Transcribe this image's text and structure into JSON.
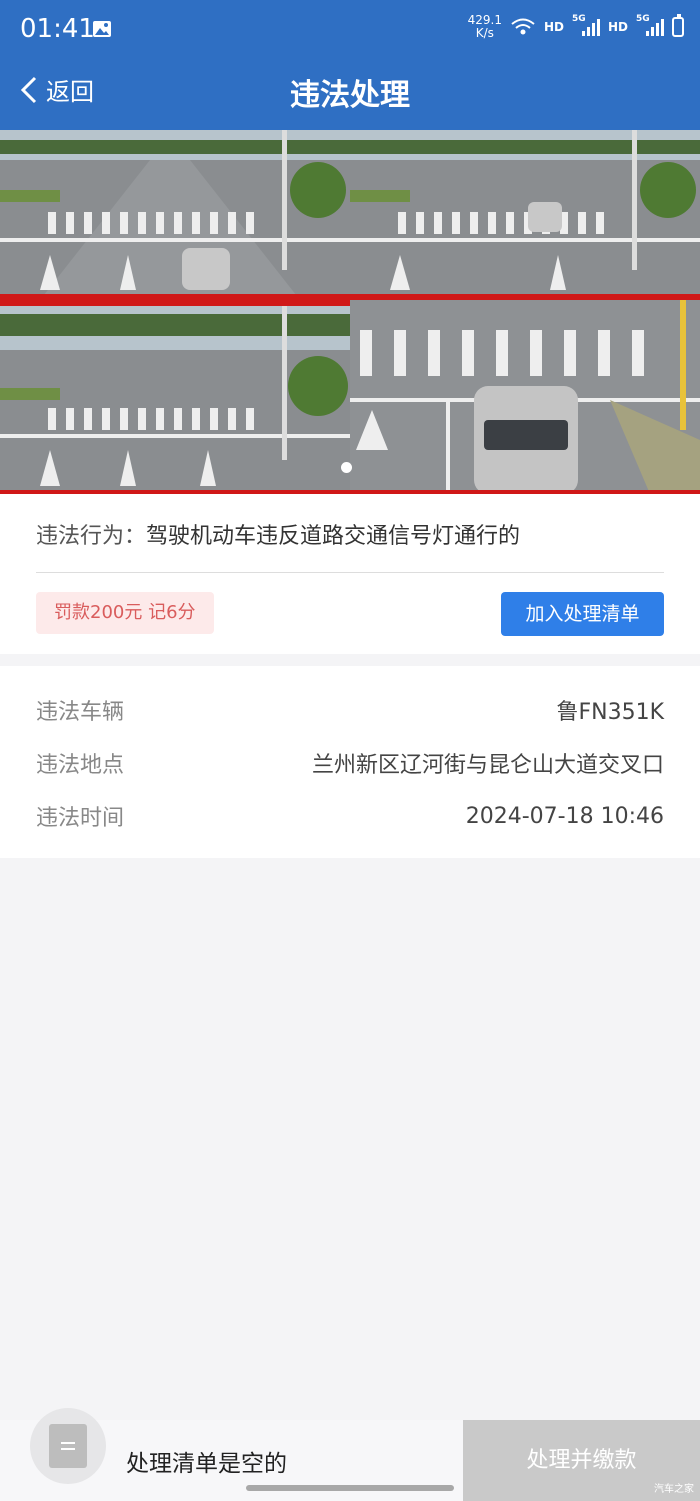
{
  "status_bar": {
    "time": "01:41",
    "net_speed_value": "429.1",
    "net_speed_unit": "K/s",
    "hd1": "HD",
    "hd2": "HD",
    "sig1_label": "5G",
    "sig2_label": "5G"
  },
  "header": {
    "back_label": "返回",
    "title": "违法处理"
  },
  "violation": {
    "behavior_label": "违法行为：",
    "behavior_value": "驾驶机动车违反道路交通信号灯通行的",
    "fine": "罚款200元 记6分",
    "add_button": "加入处理清单"
  },
  "details": {
    "rows": [
      {
        "label": "违法车辆",
        "value": "鲁FN351K"
      },
      {
        "label": "违法地点",
        "value": "兰州新区辽河街与昆仑山大道交叉口"
      },
      {
        "label": "违法时间",
        "value": "2024-07-18 10:46"
      }
    ]
  },
  "bottom": {
    "empty_text": "处理清单是空的",
    "pay_button": "处理并缴款",
    "watermark": "汽车之家"
  },
  "colors": {
    "header_bg": "#2f6fc3",
    "primary_button": "#2f7fe8",
    "fine_text": "#d95c5c",
    "fine_bg": "#fdeaea",
    "disabled_button": "#c9c9c9"
  }
}
